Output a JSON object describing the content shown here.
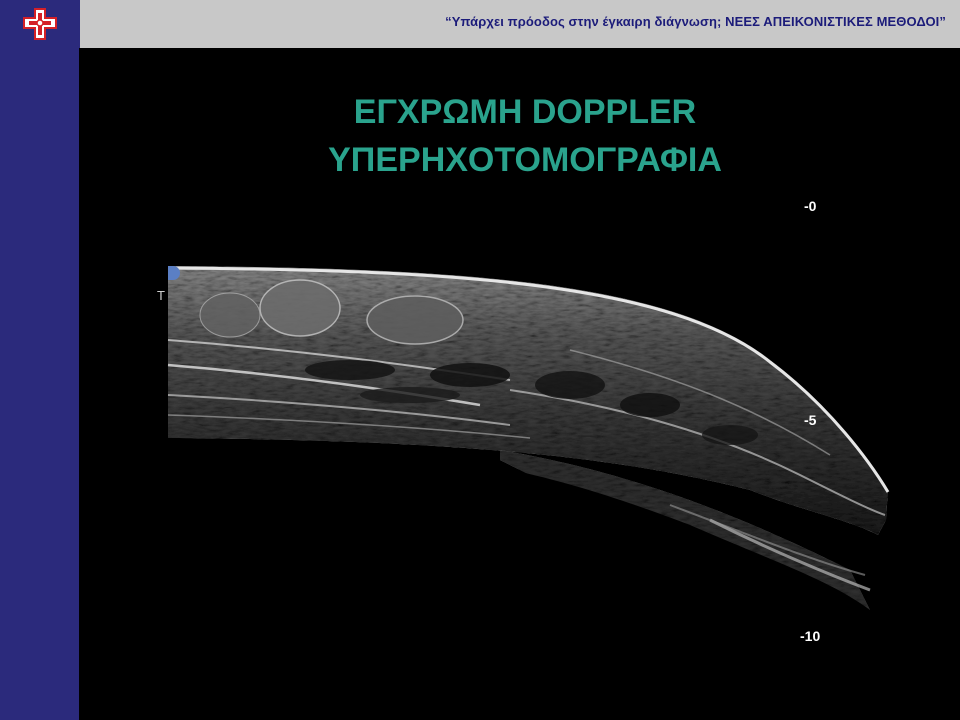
{
  "header": {
    "text": "“Υπάρχει πρόοδος στην έγκαιρη διάγνωση;  ΝΕΕΣ ΑΠΕΙΚΟΝΙΣΤΙΚΕΣ  ΜΕΘΟΔΟΙ”",
    "logo_icon": "medical-cross-logo-icon"
  },
  "title": {
    "line1": "ΕΓΧΡΩΜΗ DOPPLER",
    "line2": "ΥΠΕΡΗΧΟΤΟΜΟΓΡΑΦΙΑ"
  },
  "ultrasound": {
    "depth_labels": [
      "-0",
      "-5",
      "-10"
    ],
    "probe_marker": "P",
    "side_mark": "T"
  },
  "colors": {
    "header_bg": "#c8c8c8",
    "brand_navy": "#2b2a7c",
    "header_text": "#1c1c7a",
    "title_green": "#2aa38d",
    "logo_red": "#d42027"
  }
}
